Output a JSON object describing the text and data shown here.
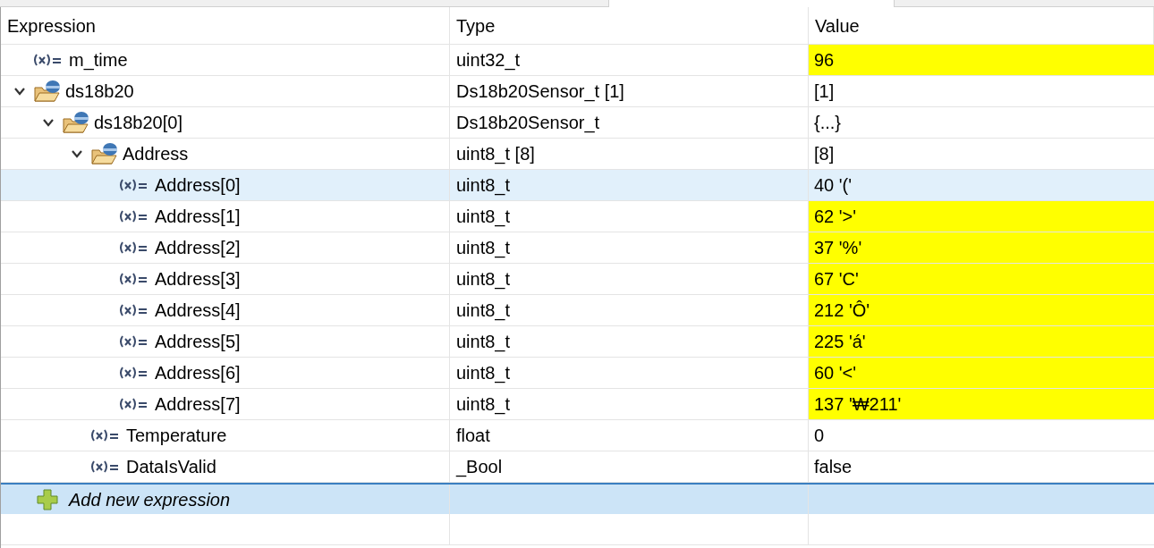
{
  "columns": [
    "Expression",
    "Type",
    "Value"
  ],
  "rows": [
    {
      "name": "m_time",
      "type": "uint32_t",
      "value": "96",
      "kind": "variable",
      "changed": true,
      "selected": false
    },
    {
      "name": "ds18b20",
      "type": "Ds18b20Sensor_t [1]",
      "value": "[1]",
      "kind": "struct",
      "expanded": true,
      "changed": false,
      "selected": false,
      "children": [
        {
          "name": "ds18b20[0]",
          "type": "Ds18b20Sensor_t",
          "value": "{...}",
          "kind": "struct",
          "expanded": true,
          "changed": false,
          "selected": false,
          "children": [
            {
              "name": "Address",
              "type": "uint8_t [8]",
              "value": "[8]",
              "kind": "struct",
              "expanded": true,
              "changed": false,
              "selected": false,
              "children": [
                {
                  "name": "Address[0]",
                  "type": "uint8_t",
                  "value": "40 '('",
                  "kind": "variable",
                  "changed": false,
                  "selected": true
                },
                {
                  "name": "Address[1]",
                  "type": "uint8_t",
                  "value": "62 '>'",
                  "kind": "variable",
                  "changed": true,
                  "selected": false
                },
                {
                  "name": "Address[2]",
                  "type": "uint8_t",
                  "value": "37 '%'",
                  "kind": "variable",
                  "changed": true,
                  "selected": false
                },
                {
                  "name": "Address[3]",
                  "type": "uint8_t",
                  "value": "67 'C'",
                  "kind": "variable",
                  "changed": true,
                  "selected": false
                },
                {
                  "name": "Address[4]",
                  "type": "uint8_t",
                  "value": "212 'Ô'",
                  "kind": "variable",
                  "changed": true,
                  "selected": false
                },
                {
                  "name": "Address[5]",
                  "type": "uint8_t",
                  "value": "225 'á'",
                  "kind": "variable",
                  "changed": true,
                  "selected": false
                },
                {
                  "name": "Address[6]",
                  "type": "uint8_t",
                  "value": "60 '<'",
                  "kind": "variable",
                  "changed": true,
                  "selected": false
                },
                {
                  "name": "Address[7]",
                  "type": "uint8_t",
                  "value": "137 '₩211'",
                  "kind": "variable",
                  "changed": true,
                  "selected": false
                }
              ]
            },
            {
              "name": "Temperature",
              "type": "float",
              "value": "0",
              "kind": "variable",
              "changed": false,
              "selected": false
            },
            {
              "name": "DataIsValid",
              "type": "_Bool",
              "value": "false",
              "kind": "variable",
              "changed": false,
              "selected": false
            }
          ]
        }
      ]
    }
  ],
  "add_row": {
    "label": "Add new expression",
    "selected": true
  }
}
